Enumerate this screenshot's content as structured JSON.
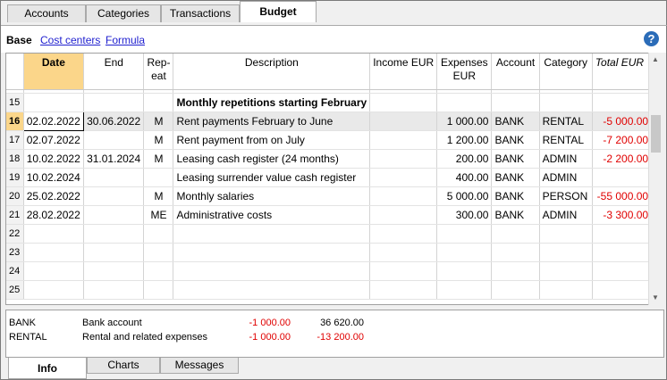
{
  "top_tabs": [
    "Accounts",
    "Categories",
    "Transactions",
    "Budget"
  ],
  "subtabs": {
    "base": "Base",
    "cost_centers": "Cost centers",
    "formula": "Formula"
  },
  "help_icon": "?",
  "columns": {
    "date": "Date",
    "end": "End",
    "repeat_line1": "Rep-",
    "repeat_line2": "eat",
    "description": "Description",
    "income": "Income EUR",
    "expenses_line1": "Expenses",
    "expenses_line2": "EUR",
    "account": "Account",
    "category": "Category",
    "total": "Total EUR"
  },
  "rows": [
    {
      "num": "15",
      "date": "",
      "end": "",
      "repeat": "",
      "description": "Monthly repetitions starting February",
      "income": "",
      "expenses": "",
      "account": "",
      "category": "",
      "total": ""
    },
    {
      "num": "16",
      "date": "02.02.2022",
      "end": "30.06.2022",
      "repeat": "M",
      "description": "Rent payments February to June",
      "income": "",
      "expenses": "1 000.00",
      "account": "BANK",
      "category": "RENTAL",
      "total": "-5 000.00"
    },
    {
      "num": "17",
      "date": "02.07.2022",
      "end": "",
      "repeat": "M",
      "description": "Rent payment from on July",
      "income": "",
      "expenses": "1 200.00",
      "account": "BANK",
      "category": "RENTAL",
      "total": "-7 200.00"
    },
    {
      "num": "18",
      "date": "10.02.2022",
      "end": "31.01.2024",
      "repeat": "M",
      "description": "Leasing cash register (24 months)",
      "income": "",
      "expenses": "200.00",
      "account": "BANK",
      "category": "ADMIN",
      "total": "-2 200.00"
    },
    {
      "num": "19",
      "date": "10.02.2024",
      "end": "",
      "repeat": "",
      "description": "Leasing surrender value cash register",
      "income": "",
      "expenses": "400.00",
      "account": "BANK",
      "category": "ADMIN",
      "total": ""
    },
    {
      "num": "20",
      "date": "25.02.2022",
      "end": "",
      "repeat": "M",
      "description": "Monthly salaries",
      "income": "",
      "expenses": "5 000.00",
      "account": "BANK",
      "category": "PERSON",
      "total": "-55 000.00"
    },
    {
      "num": "21",
      "date": "28.02.2022",
      "end": "",
      "repeat": "ME",
      "description": "Administrative costs",
      "income": "",
      "expenses": "300.00",
      "account": "BANK",
      "category": "ADMIN",
      "total": "-3 300.00"
    },
    {
      "num": "22",
      "date": "",
      "end": "",
      "repeat": "",
      "description": "",
      "income": "",
      "expenses": "",
      "account": "",
      "category": "",
      "total": ""
    },
    {
      "num": "23",
      "date": "",
      "end": "",
      "repeat": "",
      "description": "",
      "income": "",
      "expenses": "",
      "account": "",
      "category": "",
      "total": ""
    },
    {
      "num": "24",
      "date": "",
      "end": "",
      "repeat": "",
      "description": "",
      "income": "",
      "expenses": "",
      "account": "",
      "category": "",
      "total": ""
    },
    {
      "num": "25",
      "date": "",
      "end": "",
      "repeat": "",
      "description": "",
      "income": "",
      "expenses": "",
      "account": "",
      "category": "",
      "total": ""
    }
  ],
  "info": [
    {
      "code": "BANK",
      "name": "Bank account",
      "amount": "-1 000.00",
      "balance": "36 620.00"
    },
    {
      "code": "RENTAL",
      "name": "Rental and related expenses",
      "amount": "-1 000.00",
      "balance": "-13 200.00"
    }
  ],
  "bottom_tabs": [
    "Info",
    "Charts",
    "Messages"
  ],
  "colors": {
    "selected_header": "#fbd68a",
    "negative": "#e00000",
    "link": "#1f1fcf"
  }
}
